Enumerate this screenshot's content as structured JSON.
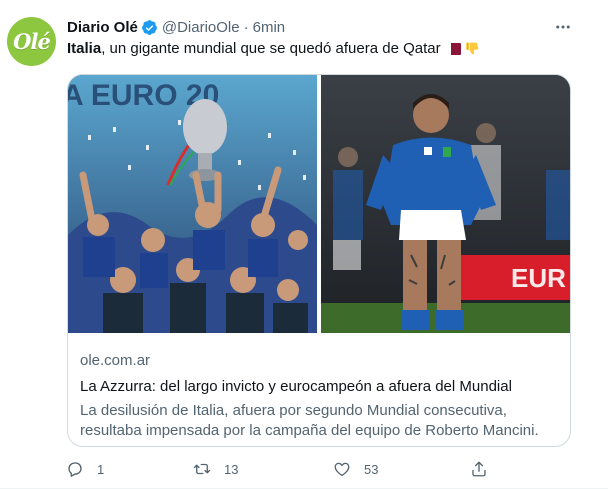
{
  "author": {
    "display_name": "Diario Olé",
    "handle": "@DiarioOle",
    "separator": "·",
    "time": "6min",
    "avatar_text": "Olé"
  },
  "tweet": {
    "bold_part": "Italia",
    "text_rest": ", un gigante mundial que se quedó afuera de Qatar"
  },
  "card": {
    "domain": "ole.com.ar",
    "title": "La Azzurra: del largo invicto y eurocampeón a afuera del Mundial",
    "description": "La desilusión de Italia, afuera por segundo Mundial consecutiva, resultaba impensada por la campaña del equipo de Roberto Mancini.",
    "left_image_overlay_text": "A EURO 20"
  },
  "actions": {
    "replies": "1",
    "retweets": "13",
    "likes": "53"
  },
  "colors": {
    "text_primary": "#0f1419",
    "text_secondary": "#536471",
    "verified_blue": "#1d9bf0",
    "avatar_green": "#8dc63f",
    "azzurri_blue": "#1f5fb4",
    "border": "#cfd9de"
  }
}
